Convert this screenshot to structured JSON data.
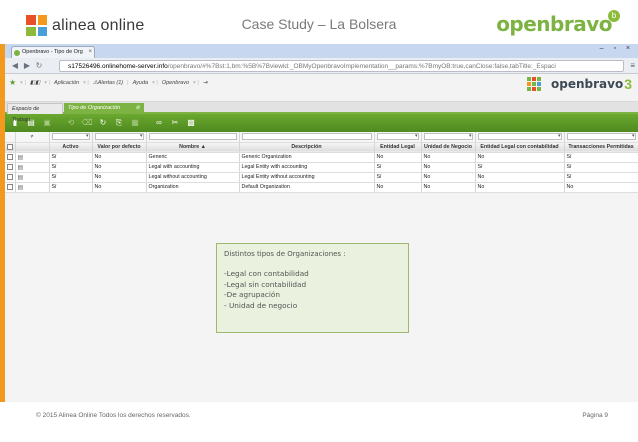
{
  "slide": {
    "brand": "alinea online",
    "title": "Case Study – La Bolsera",
    "logo": "openbravo",
    "logo_badge": "b",
    "footer_left": "© 2015 Alinea Online Todos los derechos reservados.",
    "footer_right": "Página 9"
  },
  "browser": {
    "tab_title": "Openbravo - Tipo de Org",
    "url_host": "s17526496.onlinehome-server.info",
    "url_path": "/openbravo/#%7Bst:1,bm:%5B%7Bviewld:_OBMyOpenbravoImplementation__params:%7BmyOB:true,canClose:false,tabTitle:_Espaci"
  },
  "app": {
    "nav": {
      "aplicacion": "Aplicación",
      "alertas": "Alertas (1)",
      "ayuda": "Ayuda",
      "openbravo": "Openbravo"
    },
    "brand_word": "openbravo",
    "brand_num": "3",
    "tabs": [
      {
        "label": "Espacio de Trabajo"
      },
      {
        "label": "Tipo de Organización"
      }
    ]
  },
  "grid": {
    "headers": [
      "",
      "Activo",
      "Valor por defecto",
      "Nombre ▲",
      "Descripción",
      "Entidad Legal",
      "Unidad de Negocio",
      "Entidad Legal con contabilidad",
      "Transacciones Permitidas"
    ],
    "filter_first": "≠",
    "rows": [
      {
        "activo": "Sí",
        "defecto": "No",
        "nombre": "Generic",
        "descripcion": "Generic Organization",
        "legal": "No",
        "negocio": "No",
        "legal_cont": "No",
        "trans": "Sí"
      },
      {
        "activo": "Sí",
        "defecto": "No",
        "nombre": "Legal with accounting",
        "descripcion": "Legal Entity with accounting",
        "legal": "Sí",
        "negocio": "No",
        "legal_cont": "Sí",
        "trans": "Sí"
      },
      {
        "activo": "Sí",
        "defecto": "No",
        "nombre": "Legal without accounting",
        "descripcion": "Legal Entity without accounting",
        "legal": "Sí",
        "negocio": "No",
        "legal_cont": "No",
        "trans": "Sí"
      },
      {
        "activo": "Sí",
        "defecto": "No",
        "nombre": "Organization",
        "descripcion": "Default Organization",
        "legal": "No",
        "negocio": "No",
        "legal_cont": "No",
        "trans": "No"
      }
    ]
  },
  "callout": {
    "title": "Distintos tipos de Organizaciones :",
    "items": [
      "-Legal con contabilidad",
      "-Legal sin contabilidad",
      "-De agrupación",
      "- Unidad de negocio"
    ]
  }
}
